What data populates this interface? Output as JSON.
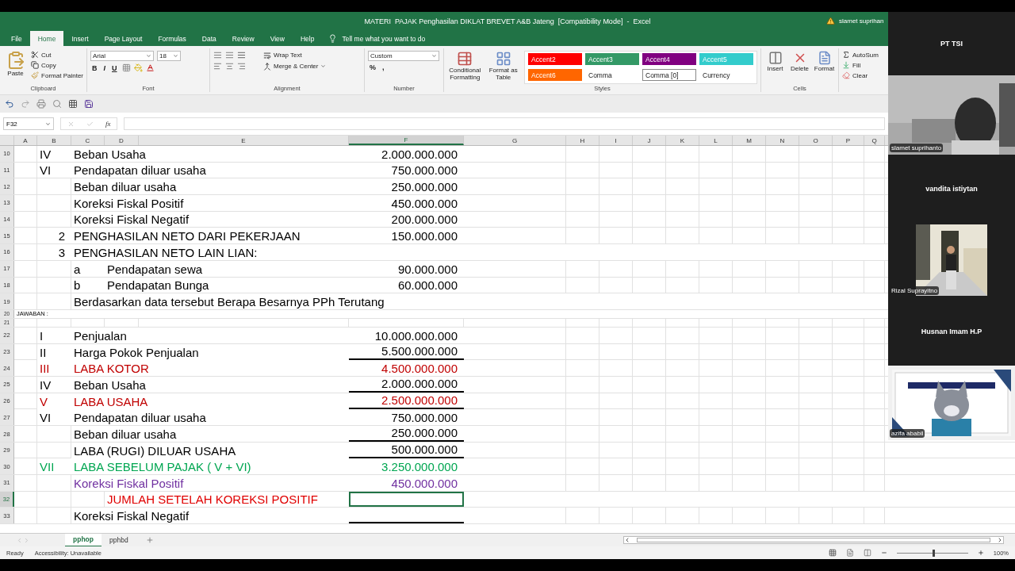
{
  "title_bar": {
    "title": "MATERI  PAJAK Penghasilan DIKLAT BREVET A&B Jateng  [Compatibility Mode]  -  Excel",
    "user": "slamet suprihan"
  },
  "ribbon_tabs": [
    {
      "label": "File",
      "selected": false
    },
    {
      "label": "Home",
      "selected": true
    },
    {
      "label": "Insert",
      "selected": false
    },
    {
      "label": "Page Layout",
      "selected": false
    },
    {
      "label": "Formulas",
      "selected": false
    },
    {
      "label": "Data",
      "selected": false
    },
    {
      "label": "Review",
      "selected": false
    },
    {
      "label": "View",
      "selected": false
    },
    {
      "label": "Help",
      "selected": false
    }
  ],
  "tell_me": "Tell me what you want to do",
  "clipboard": {
    "paste": "Paste",
    "cut": "Cut",
    "copy": "Copy",
    "format_painter": "Format Painter",
    "group": "Clipboard"
  },
  "font": {
    "name": "Arial",
    "size": "18",
    "bold": "B",
    "italic": "I",
    "underline": "U",
    "group": "Font"
  },
  "alignment": {
    "wrap": "Wrap Text",
    "merge": "Merge & Center",
    "group": "Alignment"
  },
  "number": {
    "format": "Custom",
    "percent": "%",
    "comma": ",",
    "group": "Number"
  },
  "styles": {
    "conditional": "Conditional Formatting",
    "table": "Format as Table",
    "group": "Styles",
    "cells": [
      {
        "label": "Accent2",
        "color": "#ff0000",
        "selected": false
      },
      {
        "label": "Accent3",
        "color": "#339966",
        "selected": false
      },
      {
        "label": "Accent4",
        "color": "#800080",
        "selected": false
      },
      {
        "label": "Accent5",
        "color": "#33cccc",
        "selected": false
      },
      {
        "label": "Accent6",
        "color": "#ff6600",
        "selected": false
      },
      {
        "label": "Comma",
        "selected": false
      },
      {
        "label": "Comma [0]",
        "selected": true
      },
      {
        "label": "Currency",
        "selected": false
      }
    ]
  },
  "cells_group": {
    "insert": "Insert",
    "delete": "Delete",
    "format": "Format",
    "group": "Cells"
  },
  "editing": {
    "autosum": "AutoSum",
    "fill": "Fill",
    "clear": "Clear"
  },
  "formula_bar": {
    "name_box": "F32",
    "fx": "fx"
  },
  "columns": [
    {
      "label": "A",
      "selected": false
    },
    {
      "label": "B",
      "selected": false
    },
    {
      "label": "C",
      "selected": false
    },
    {
      "label": "D",
      "selected": false
    },
    {
      "label": "E",
      "selected": false
    },
    {
      "label": "F",
      "selected": true
    },
    {
      "label": "G",
      "selected": false
    },
    {
      "label": "H",
      "selected": false
    },
    {
      "label": "I",
      "selected": false
    },
    {
      "label": "J",
      "selected": false
    },
    {
      "label": "K",
      "selected": false
    },
    {
      "label": "L",
      "selected": false
    },
    {
      "label": "M",
      "selected": false
    },
    {
      "label": "N",
      "selected": false
    },
    {
      "label": "O",
      "selected": false
    },
    {
      "label": "P",
      "selected": false
    },
    {
      "label": "Q",
      "selected": false
    }
  ],
  "rows": [
    {
      "num": "10",
      "kind": "normal",
      "selected": false,
      "cells": {
        "B": {
          "text": "IV"
        },
        "C": {
          "text": "Beban Usaha"
        },
        "F": {
          "text": "2.000.000.000",
          "kind": "number"
        }
      }
    },
    {
      "num": "11",
      "kind": "normal",
      "selected": false,
      "cells": {
        "B": {
          "text": "VI"
        },
        "C": {
          "text": "Pendapatan diluar usaha"
        },
        "F": {
          "text": "750.000.000",
          "kind": "number"
        }
      }
    },
    {
      "num": "12",
      "kind": "normal",
      "selected": false,
      "cells": {
        "C": {
          "text": "Beban diluar usaha"
        },
        "F": {
          "text": "250.000.000",
          "kind": "number"
        }
      }
    },
    {
      "num": "13",
      "kind": "normal",
      "selected": false,
      "cells": {
        "C": {
          "text": "Koreksi Fiskal Positif"
        },
        "F": {
          "text": "450.000.000",
          "kind": "number"
        }
      }
    },
    {
      "num": "14",
      "kind": "normal",
      "selected": false,
      "cells": {
        "C": {
          "text": "Koreksi Fiskal Negatif"
        },
        "F": {
          "text": "200.000.000",
          "kind": "number"
        }
      }
    },
    {
      "num": "15",
      "kind": "normal",
      "selected": false,
      "cells": {
        "B": {
          "text": "2",
          "kind": "number"
        },
        "C": {
          "text": "PENGHASILAN NETO DARI PEKERJAAN"
        },
        "F": {
          "text": "150.000.000",
          "kind": "number"
        }
      }
    },
    {
      "num": "16",
      "kind": "normal",
      "selected": false,
      "cells": {
        "B": {
          "text": "3",
          "kind": "number"
        },
        "C": {
          "text": "PENGHASILAN  NETO LAIN LIAN:"
        }
      }
    },
    {
      "num": "17",
      "kind": "normal",
      "selected": false,
      "cells": {
        "C": {
          "text": "a"
        },
        "D": {
          "text": "Pendapatan sewa"
        },
        "F": {
          "text": "90.000.000",
          "kind": "number"
        }
      }
    },
    {
      "num": "18",
      "kind": "normal",
      "selected": false,
      "cells": {
        "C": {
          "text": "b"
        },
        "D": {
          "text": "Pendapatan Bunga"
        },
        "F": {
          "text": "60.000.000",
          "kind": "number"
        }
      }
    },
    {
      "num": "19",
      "kind": "normal",
      "selected": false,
      "cells": {
        "C": {
          "text": "Berdasarkan data tersebut Berapa Besarnya PPh Terutang"
        }
      }
    },
    {
      "num": "20",
      "kind": "small",
      "selected": false,
      "cells": {
        "A": {
          "text": "JAWABAN :"
        }
      }
    },
    {
      "num": "21",
      "kind": "small",
      "selected": false,
      "cells": {}
    },
    {
      "num": "22",
      "kind": "normal",
      "selected": false,
      "cells": {
        "B": {
          "text": "I"
        },
        "C": {
          "text": "Penjualan"
        },
        "F": {
          "text": "10.000.000.000",
          "kind": "number"
        }
      }
    },
    {
      "num": "23",
      "kind": "normal",
      "selected": false,
      "cells": {
        "B": {
          "text": "II"
        },
        "C": {
          "text": "Harga Pokok Penjualan"
        },
        "F": {
          "text": "5.500.000.000",
          "kind": "number",
          "underlined": true
        }
      }
    },
    {
      "num": "24",
      "kind": "normal",
      "selected": false,
      "cells": {
        "B": {
          "text": "III",
          "color": "#c00000"
        },
        "C": {
          "text": "LABA KOTOR",
          "color": "#c00000"
        },
        "F": {
          "text": "4.500.000.000",
          "kind": "number",
          "color": "#c00000"
        }
      }
    },
    {
      "num": "25",
      "kind": "normal",
      "selected": false,
      "cells": {
        "B": {
          "text": "IV"
        },
        "C": {
          "text": "Beban Usaha"
        },
        "F": {
          "text": "2.000.000.000",
          "kind": "number",
          "underlined": true
        }
      }
    },
    {
      "num": "26",
      "kind": "normal",
      "selected": false,
      "cells": {
        "B": {
          "text": "V",
          "color": "#c00000"
        },
        "C": {
          "text": "LABA USAHA",
          "color": "#c00000"
        },
        "F": {
          "text": "2.500.000.000",
          "kind": "number",
          "color": "#c00000",
          "underlined": true
        }
      }
    },
    {
      "num": "27",
      "kind": "normal",
      "selected": false,
      "cells": {
        "B": {
          "text": "VI"
        },
        "C": {
          "text": "Pendapatan diluar usaha"
        },
        "F": {
          "text": "750.000.000",
          "kind": "number"
        }
      }
    },
    {
      "num": "28",
      "kind": "normal",
      "selected": false,
      "cells": {
        "C": {
          "text": "Beban diluar usaha"
        },
        "F": {
          "text": "250.000.000",
          "kind": "number",
          "underlined": true
        }
      }
    },
    {
      "num": "29",
      "kind": "normal",
      "selected": false,
      "cells": {
        "C": {
          "text": "LABA (RUGI) DILUAR USAHA"
        },
        "F": {
          "text": "500.000.000",
          "kind": "number",
          "underlined": true
        }
      }
    },
    {
      "num": "30",
      "kind": "normal",
      "selected": false,
      "cells": {
        "B": {
          "text": "VII",
          "color": "#00a651"
        },
        "C": {
          "text": "LABA SEBELUM PAJAK ( V + VI)",
          "color": "#00a651"
        },
        "F": {
          "text": "3.250.000.000",
          "kind": "number",
          "color": "#00a651"
        }
      }
    },
    {
      "num": "31",
      "kind": "normal",
      "selected": false,
      "cells": {
        "C": {
          "text": "Koreksi Fiskal Positif",
          "color": "#7030a0"
        },
        "F": {
          "text": "450.000.000",
          "kind": "number",
          "color": "#7030a0"
        }
      }
    },
    {
      "num": "32",
      "kind": "normal",
      "selected": true,
      "cells": {
        "D": {
          "text": "JUMLAH SETELAH KOREKSI POSITIF",
          "color": "#e00000"
        }
      }
    },
    {
      "num": "33",
      "kind": "normal",
      "selected": false,
      "cells": {
        "C": {
          "text": "Koreksi Fiskal Negatif"
        },
        "F": {
          "underlined": true
        }
      }
    }
  ],
  "sheet_tabs": [
    {
      "label": "pphop",
      "selected": true
    },
    {
      "label": "pphbd",
      "selected": false
    }
  ],
  "status_bar": {
    "ready": "Ready",
    "accessibility": "Accessibility: Unavailable",
    "zoom": "100%",
    "zoom_slider": {
      "level": 0.5
    }
  },
  "participants": [
    {
      "name": "PT TSI",
      "kind": "name"
    },
    {
      "name": "slamet suprihanto",
      "kind": "video"
    },
    {
      "name": "vandita istiytan",
      "kind": "name"
    },
    {
      "name": "Rizal Suprayitno"
    },
    {
      "name": "Husnan Imam H.P",
      "kind": "name"
    },
    {
      "name": "azifa ababil",
      "kind": "avatar"
    }
  ]
}
